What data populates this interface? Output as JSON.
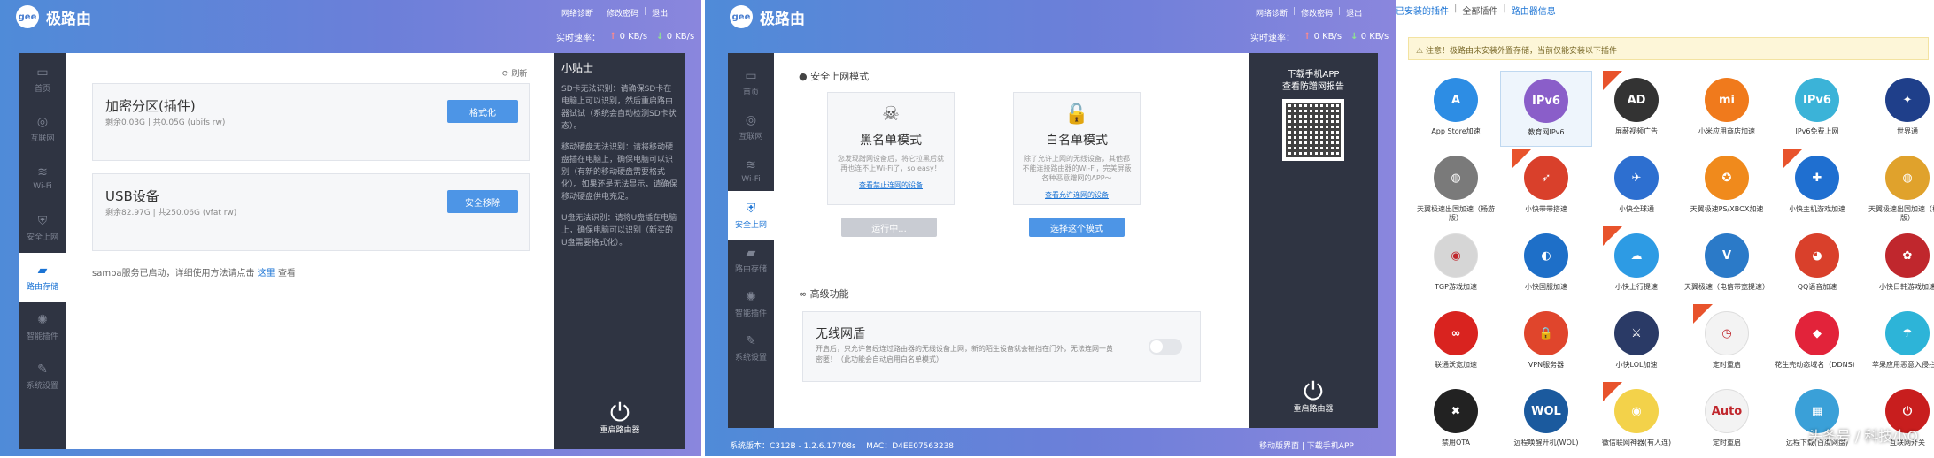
{
  "panel1": {
    "logo_badge": "gee",
    "logo_text": "极路由",
    "toplinks": [
      "网络诊断",
      "修改密码",
      "退出"
    ],
    "speed_label": "实时速率：",
    "speed_up": "0 KB/s",
    "speed_down": "0 KB/s",
    "nav": [
      {
        "icon": "▭",
        "label": "首页"
      },
      {
        "icon": "◎",
        "label": "互联网"
      },
      {
        "icon": "≋",
        "label": "Wi-Fi"
      },
      {
        "icon": "⛨",
        "label": "安全上网"
      },
      {
        "icon": "▰",
        "label": "路由存储"
      },
      {
        "icon": "✺",
        "label": "智能插件"
      },
      {
        "icon": "✎",
        "label": "系统设置"
      }
    ],
    "refresh": "刷新",
    "partition": {
      "title": "加密分区(插件)",
      "sub": "剩余0.03G | 共0.05G (ubifs rw)",
      "button": "格式化"
    },
    "usb": {
      "title": "USB设备",
      "sub": "剩余82.97G | 共250.06G (vfat rw)",
      "button": "安全移除"
    },
    "samba_pre": "samba服务已启动，详细使用方法请点击",
    "samba_link": "这里",
    "samba_post": "查看",
    "tips_title": "小贴士",
    "tips": [
      "SD卡无法识别：请确保SD卡在电脑上可以识别，然后重启路由器试试（系统会自动检测SD卡状态）。",
      "移动硬盘无法识别：请将移动硬盘插在电脑上，确保电脑可以识别（有新的移动硬盘需要格式化）。如果还是无法显示，请确保移动硬盘供电充足。",
      "U盘无法识别：请将U盘插在电脑上，确保电脑可以识别（新买的U盘需要格式化）。"
    ],
    "power_label": "重启路由器"
  },
  "panel2": {
    "logo_badge": "gee",
    "logo_text": "极路由",
    "toplinks": [
      "网络诊断",
      "修改密码",
      "退出"
    ],
    "speed_label": "实时速率：",
    "speed_up": "0 KB/s",
    "speed_down": "0 KB/s",
    "nav": [
      {
        "icon": "▭",
        "label": "首页"
      },
      {
        "icon": "◎",
        "label": "互联网"
      },
      {
        "icon": "≋",
        "label": "Wi-Fi"
      },
      {
        "icon": "⛨",
        "label": "安全上网"
      },
      {
        "icon": "▰",
        "label": "路由存储"
      },
      {
        "icon": "✺",
        "label": "智能插件"
      },
      {
        "icon": "✎",
        "label": "系统设置"
      }
    ],
    "section1": "安全上网模式",
    "black": {
      "title": "黑名单模式",
      "desc": "您发现蹭网设备后，将它拉黑后就再也连不上Wi-Fi了，so easy！",
      "link": "查看禁止连网的设备",
      "button": "运行中..."
    },
    "white": {
      "title": "白名单模式",
      "desc": "除了允许上网的无线设备，其他都不能连接路由器的Wi-Fi，完美屏蔽各种恶意蹭网的APP～",
      "link": "查看允许连网的设备",
      "button": "选择这个模式"
    },
    "section2": "高级功能",
    "wireless": {
      "title": "无线网盾",
      "desc": "开启后，只允许曾经连过路由器的无线设备上网，新的陌生设备就会被挡在门外，无法连网一黄密匿！（此功能会自动启用白名单模式）"
    },
    "app_title": "下载手机APP",
    "app_sub": "查看防蹭网报告",
    "power_label": "重启路由器",
    "footer_version": "系统版本：C312B - 1.2.6.17708s",
    "footer_mac": "MAC：D4EE07563238",
    "footer_links": [
      "移动版界面",
      "下载手机APP"
    ]
  },
  "panel3": {
    "tabs": [
      "已安装的插件",
      "全部插件",
      "路由器信息"
    ],
    "notice": "注意！极路由未安装外置存储，当前仅能安装以下插件",
    "plugins": [
      {
        "name": "App Store加速",
        "icon": "A",
        "color": "#2d8de4",
        "hot": false
      },
      {
        "name": "教育网IPv6",
        "icon": "IPv6",
        "color": "#8a5ec9",
        "hot": false
      },
      {
        "name": "屏蔽视频广告",
        "icon": "AD",
        "color": "#333333",
        "hot": true
      },
      {
        "name": "小米应用商店加速",
        "icon": "mi",
        "color": "#f07a1c",
        "hot": false
      },
      {
        "name": "IPv6免费上网",
        "icon": "IPv6",
        "color": "#3bb3d8",
        "hot": false
      },
      {
        "name": "世界通",
        "icon": "✦",
        "color": "#1f3f8a",
        "hot": false
      },
      {
        "name": "天翼极速出国加速（畅游版）",
        "icon": "◍",
        "color": "#7a7a7a",
        "hot": false
      },
      {
        "name": "小快带带搭速",
        "icon": "➶",
        "color": "#d9402b",
        "hot": true
      },
      {
        "name": "小快全球通",
        "icon": "✈",
        "color": "#2d6fd0",
        "hot": false
      },
      {
        "name": "天翼极速PS/XBOX加速",
        "icon": "✪",
        "color": "#f08a1c",
        "hot": false
      },
      {
        "name": "小快主机游戏加速",
        "icon": "✚",
        "color": "#1f6fd0",
        "hot": true
      },
      {
        "name": "天翼极速出国加速（极速版）",
        "icon": "◍",
        "color": "#e0a22c",
        "hot": false
      },
      {
        "name": "TGP游戏加速",
        "icon": "◉",
        "color": "#d6d6d6",
        "hot": false
      },
      {
        "name": "小快国服加速",
        "icon": "◐",
        "color": "#1e6fc8",
        "hot": false
      },
      {
        "name": "小快上行提速",
        "icon": "☁",
        "color": "#2d9be4",
        "hot": true
      },
      {
        "name": "天翼极速（电信带宽提速）",
        "icon": "V",
        "color": "#2b7ac8",
        "hot": false
      },
      {
        "name": "QQ语音加速",
        "icon": "◕",
        "color": "#d9402b",
        "hot": false
      },
      {
        "name": "小快日韩游戏加速",
        "icon": "✿",
        "color": "#c0272d",
        "hot": false
      },
      {
        "name": "联通沃宽加速",
        "icon": "∞",
        "color": "#d9231f",
        "hot": false
      },
      {
        "name": "VPN服务器",
        "icon": "🔒",
        "color": "#e0452c",
        "hot": false
      },
      {
        "name": "小快LOL加速",
        "icon": "⚔",
        "color": "#2a3a66",
        "hot": false
      },
      {
        "name": "定时重启",
        "icon": "◷",
        "color": "#f3f3f3",
        "hot": true
      },
      {
        "name": "花生壳动态域名（DDNS）",
        "icon": "◆",
        "color": "#e2233a",
        "hot": false
      },
      {
        "name": "苹果应用恶意入侵拦截",
        "icon": "☂",
        "color": "#2db4d8",
        "hot": false
      },
      {
        "name": "禁用OTA",
        "icon": "✖",
        "color": "#222222",
        "hot": false
      },
      {
        "name": "远程唤醒开机(WOL)",
        "icon": "WOL",
        "color": "#1b5a9e",
        "hot": false
      },
      {
        "name": "微信联网神器(有人连)",
        "icon": "◉",
        "color": "#f3d24a",
        "hot": true
      },
      {
        "name": "定时重启",
        "icon": "Auto",
        "color": "#f3f3f3",
        "hot": false
      },
      {
        "name": "远程下载(百度网盘)",
        "icon": "▦",
        "color": "#3aa0d8",
        "hot": false
      },
      {
        "name": "互联网开关",
        "icon": "⏻",
        "color": "#c81e1e",
        "hot": false
      }
    ],
    "watermark": "头条号 / 科技小Q"
  }
}
